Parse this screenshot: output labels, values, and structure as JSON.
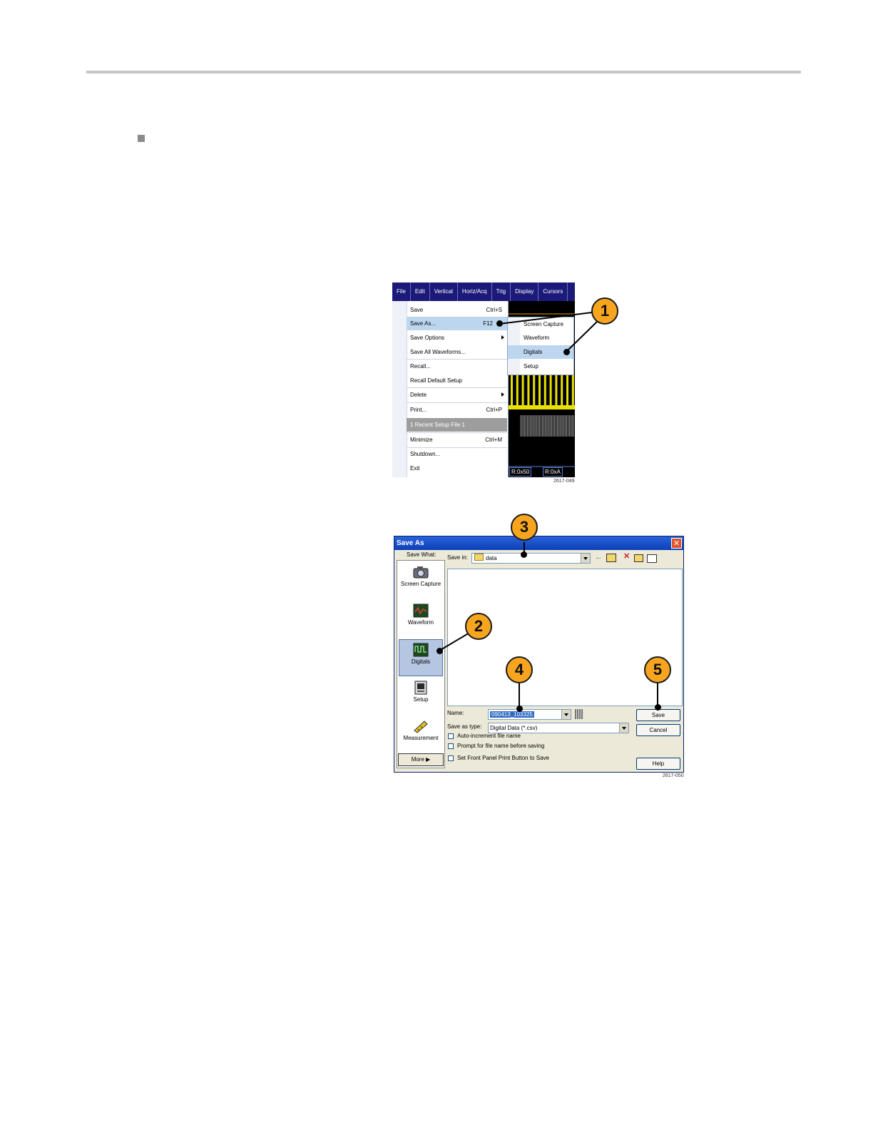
{
  "menu_figure": {
    "menubar": [
      "File",
      "Edit",
      "Vertical",
      "Horiz/Acq",
      "Trig",
      "Display",
      "Cursors"
    ],
    "file_menu": [
      {
        "label": "Save",
        "shortcut": "Ctrl+S"
      },
      {
        "label": "Save As...",
        "shortcut": "F12"
      },
      {
        "label": "Save Options",
        "shortcut": ""
      },
      {
        "label": "Save All Waveforms...",
        "shortcut": ""
      },
      {
        "label": "Recall...",
        "shortcut": ""
      },
      {
        "label": "Recall Default Setup",
        "shortcut": ""
      },
      {
        "label": "Delete",
        "shortcut": ""
      },
      {
        "label": "Print...",
        "shortcut": "Ctrl+P"
      },
      {
        "label": "1 Recent Setup File 1",
        "shortcut": ""
      },
      {
        "label": "Minimize",
        "shortcut": "Ctrl+M"
      },
      {
        "label": "Shutdown...",
        "shortcut": ""
      },
      {
        "label": "Exit",
        "shortcut": ""
      }
    ],
    "submenu": [
      "Screen Capture",
      "Waveform",
      "Digitals",
      "Setup"
    ],
    "readouts": [
      "R:0x50",
      "R:0xA"
    ],
    "figure_number": "2617-049"
  },
  "dialog": {
    "title": "Save As",
    "close_glyph": "✕",
    "save_what_label": "Save What:",
    "save_what_items": [
      "Screen Capture",
      "Waveform",
      "Digitals",
      "Setup",
      "Measurement"
    ],
    "more_label": "More",
    "save_in_label": "Save in:",
    "save_in_value": "data",
    "name_label": "Name:",
    "name_value": "090413_103325",
    "save_as_type_label": "Save as type:",
    "save_as_type_value": "Digital Data (*.csv)",
    "checkboxes": [
      "Auto-increment file name",
      "Prompt for file name before saving",
      "Set Front Panel Print Button to Save"
    ],
    "buttons": {
      "save": "Save",
      "cancel": "Cancel",
      "help": "Help"
    },
    "figure_number": "2617-050"
  },
  "callouts": [
    "1",
    "2",
    "3",
    "4",
    "5"
  ],
  "colors": {
    "menubar": "#1b1a7a",
    "highlight": "#bcd6f0",
    "callout": "#f7a51f",
    "trace_yellow": "#e8e000",
    "titlebar": "#0b3fb8"
  },
  "icons": [
    "camera-icon",
    "waveform-icon",
    "digitals-icon",
    "setup-icon",
    "measurement-icon",
    "folder-icon",
    "back-arrow-icon",
    "up-folder-icon",
    "delete-icon",
    "new-folder-icon",
    "view-menu-icon",
    "keypad-icon",
    "close-icon"
  ]
}
